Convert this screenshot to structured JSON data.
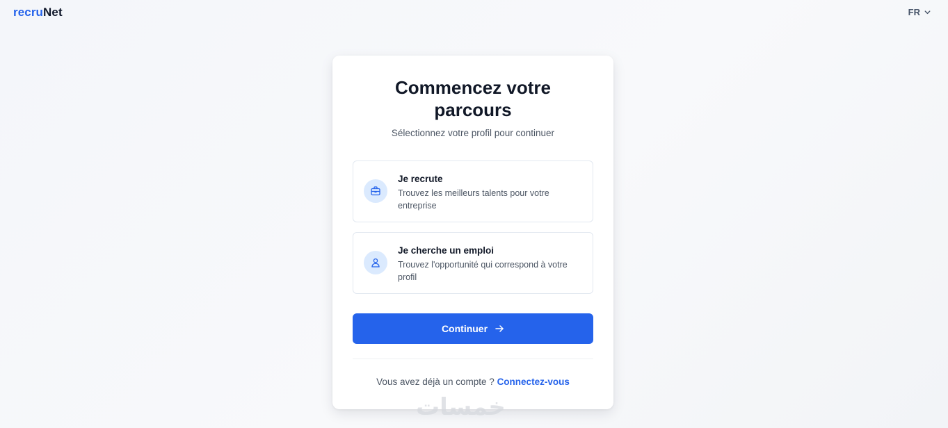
{
  "header": {
    "logo_part1": "recru",
    "logo_part2": "Net",
    "language": "FR",
    "icons": {
      "language": "chevron-down-icon"
    }
  },
  "card": {
    "title": "Commencez votre parcours",
    "subtitle": "Sélectionnez votre profil pour continuer",
    "options": [
      {
        "title": "Je recrute",
        "description": "Trouvez les meilleurs talents pour votre entreprise",
        "icon": "briefcase-icon"
      },
      {
        "title": "Je cherche un emploi",
        "description": "Trouvez l'opportunité qui correspond à votre profil",
        "icon": "user-icon"
      }
    ],
    "continue_label": "Continuer",
    "login_prompt": "Vous avez déjà un compte ?",
    "login_link": "Connectez-vous"
  },
  "watermark": "خمسات",
  "colors": {
    "accent": "#2563eb",
    "icon_bg": "#dbeafe",
    "text": "#111827",
    "muted": "#4b5563",
    "background": "#f4f6fa"
  }
}
